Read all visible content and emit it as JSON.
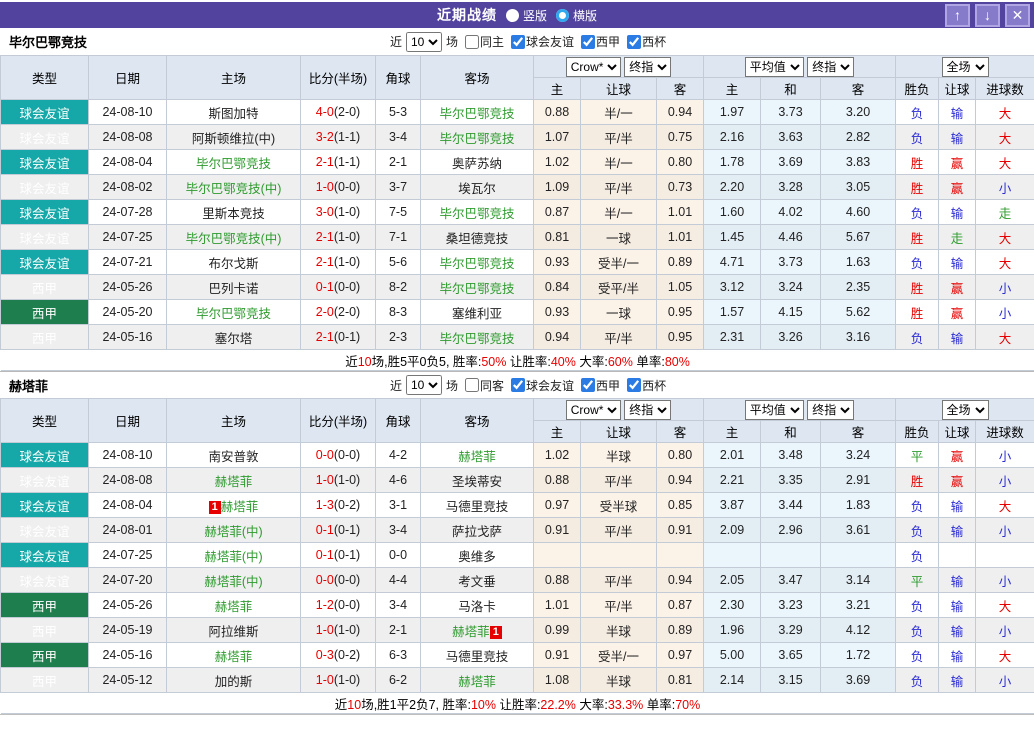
{
  "titlebar": {
    "title": "近期战绩",
    "vertical_label": "竖版",
    "horizontal_label": "横版",
    "up_icon": "↑",
    "down_icon": "↓",
    "close_icon": "✕"
  },
  "colors": {
    "titlebar_purple": "#52439E",
    "button_purple": "#867BCB",
    "friendly_teal": "#16A8A8",
    "laliga_green": "#1E7E4D",
    "header_blue": "#DDE6F1",
    "focus_team_green": "#2E9B2E",
    "win_red": "#E60000",
    "lose_blue": "#2B2BD5",
    "draw_green": "#2E9B2E"
  },
  "filter": {
    "near": "近",
    "count": "10",
    "games": "场"
  },
  "columns": {
    "type": "类型",
    "date": "日期",
    "home": "主场",
    "score": "比分(半场)",
    "corner": "角球",
    "away": "客场",
    "crow_select": "Crow*",
    "final_select": "终指",
    "avg_select": "平均值",
    "full_select": "全场",
    "sub": [
      "主",
      "让球",
      "客",
      "主",
      "和",
      "客",
      "胜负",
      "让球",
      "进球数"
    ]
  },
  "sections": [
    {
      "team": "毕尔巴鄂竞技",
      "same_label": "同主",
      "same_checked": false,
      "leagues": [
        "球会友谊",
        "西甲",
        "西杯"
      ],
      "rows": [
        {
          "tp": "球会友谊",
          "lg": "f",
          "dt": "24-08-10",
          "hm": "斯图加特",
          "hg": 0,
          "hb": "",
          "sc": "4-0",
          "hf": "(2-0)",
          "cn": "5-3",
          "aw": "毕尔巴鄂竞技",
          "ag": 1,
          "ab": "",
          "od": [
            "0.88",
            "半/一",
            "0.94"
          ],
          "av": [
            "1.97",
            "3.73",
            "3.20"
          ],
          "rs": [
            [
              "负",
              "b"
            ],
            [
              "输",
              "b"
            ],
            [
              "大",
              "r"
            ]
          ]
        },
        {
          "tp": "球会友谊",
          "lg": "f",
          "dt": "24-08-08",
          "hm": "阿斯顿维拉(中)",
          "hg": 0,
          "hb": "",
          "sc": "3-2",
          "hf": "(1-1)",
          "cn": "3-4",
          "aw": "毕尔巴鄂竞技",
          "ag": 1,
          "ab": "",
          "od": [
            "1.07",
            "平/半",
            "0.75"
          ],
          "av": [
            "2.16",
            "3.63",
            "2.82"
          ],
          "rs": [
            [
              "负",
              "b"
            ],
            [
              "输",
              "b"
            ],
            [
              "大",
              "r"
            ]
          ]
        },
        {
          "tp": "球会友谊",
          "lg": "f",
          "dt": "24-08-04",
          "hm": "毕尔巴鄂竞技",
          "hg": 1,
          "hb": "",
          "sc": "2-1",
          "hf": "(1-1)",
          "cn": "2-1",
          "aw": "奥萨苏纳",
          "ag": 0,
          "ab": "",
          "od": [
            "1.02",
            "半/一",
            "0.80"
          ],
          "av": [
            "1.78",
            "3.69",
            "3.83"
          ],
          "rs": [
            [
              "胜",
              "r"
            ],
            [
              "赢",
              "r"
            ],
            [
              "大",
              "r"
            ]
          ]
        },
        {
          "tp": "球会友谊",
          "lg": "f",
          "dt": "24-08-02",
          "hm": "毕尔巴鄂竞技(中)",
          "hg": 1,
          "hb": "",
          "sc": "1-0",
          "hf": "(0-0)",
          "cn": "3-7",
          "aw": "埃瓦尔",
          "ag": 0,
          "ab": "",
          "od": [
            "1.09",
            "平/半",
            "0.73"
          ],
          "av": [
            "2.20",
            "3.28",
            "3.05"
          ],
          "rs": [
            [
              "胜",
              "r"
            ],
            [
              "赢",
              "r"
            ],
            [
              "小",
              "b"
            ]
          ]
        },
        {
          "tp": "球会友谊",
          "lg": "f",
          "dt": "24-07-28",
          "hm": "里斯本竞技",
          "hg": 0,
          "hb": "",
          "sc": "3-0",
          "hf": "(1-0)",
          "cn": "7-5",
          "aw": "毕尔巴鄂竞技",
          "ag": 1,
          "ab": "",
          "od": [
            "0.87",
            "半/一",
            "1.01"
          ],
          "av": [
            "1.60",
            "4.02",
            "4.60"
          ],
          "rs": [
            [
              "负",
              "b"
            ],
            [
              "输",
              "b"
            ],
            [
              "走",
              "g"
            ]
          ]
        },
        {
          "tp": "球会友谊",
          "lg": "f",
          "dt": "24-07-25",
          "hm": "毕尔巴鄂竞技(中)",
          "hg": 1,
          "hb": "",
          "sc": "2-1",
          "hf": "(1-0)",
          "cn": "7-1",
          "aw": "桑坦德竞技",
          "ag": 0,
          "ab": "",
          "od": [
            "0.81",
            "一球",
            "1.01"
          ],
          "av": [
            "1.45",
            "4.46",
            "5.67"
          ],
          "rs": [
            [
              "胜",
              "r"
            ],
            [
              "走",
              "g"
            ],
            [
              "大",
              "r"
            ]
          ]
        },
        {
          "tp": "球会友谊",
          "lg": "f",
          "dt": "24-07-21",
          "hm": "布尔戈斯",
          "hg": 0,
          "hb": "",
          "sc": "2-1",
          "hf": "(1-0)",
          "cn": "5-6",
          "aw": "毕尔巴鄂竞技",
          "ag": 1,
          "ab": "",
          "od": [
            "0.93",
            "受半/一",
            "0.89"
          ],
          "av": [
            "4.71",
            "3.73",
            "1.63"
          ],
          "rs": [
            [
              "负",
              "b"
            ],
            [
              "输",
              "b"
            ],
            [
              "大",
              "r"
            ]
          ]
        },
        {
          "tp": "西甲",
          "lg": "l",
          "dt": "24-05-26",
          "hm": "巴列卡诺",
          "hg": 0,
          "hb": "",
          "sc": "0-1",
          "hf": "(0-0)",
          "cn": "8-2",
          "aw": "毕尔巴鄂竞技",
          "ag": 1,
          "ab": "",
          "od": [
            "0.84",
            "受平/半",
            "1.05"
          ],
          "av": [
            "3.12",
            "3.24",
            "2.35"
          ],
          "rs": [
            [
              "胜",
              "r"
            ],
            [
              "赢",
              "r"
            ],
            [
              "小",
              "b"
            ]
          ]
        },
        {
          "tp": "西甲",
          "lg": "l",
          "dt": "24-05-20",
          "hm": "毕尔巴鄂竞技",
          "hg": 1,
          "hb": "",
          "sc": "2-0",
          "hf": "(2-0)",
          "cn": "8-3",
          "aw": "塞维利亚",
          "ag": 0,
          "ab": "",
          "od": [
            "0.93",
            "一球",
            "0.95"
          ],
          "av": [
            "1.57",
            "4.15",
            "5.62"
          ],
          "rs": [
            [
              "胜",
              "r"
            ],
            [
              "赢",
              "r"
            ],
            [
              "小",
              "b"
            ]
          ]
        },
        {
          "tp": "西甲",
          "lg": "l",
          "dt": "24-05-16",
          "hm": "塞尔塔",
          "hg": 0,
          "hb": "",
          "sc": "2-1",
          "hf": "(0-1)",
          "cn": "2-3",
          "aw": "毕尔巴鄂竞技",
          "ag": 1,
          "ab": "",
          "od": [
            "0.94",
            "平/半",
            "0.95"
          ],
          "av": [
            "2.31",
            "3.26",
            "3.16"
          ],
          "rs": [
            [
              "负",
              "b"
            ],
            [
              "输",
              "b"
            ],
            [
              "大",
              "r"
            ]
          ]
        }
      ],
      "summary_parts": [
        [
          "近",
          "k"
        ],
        [
          "10",
          "r"
        ],
        [
          "场,胜5平0负5, 胜率:",
          "k"
        ],
        [
          "50%",
          "r"
        ],
        [
          " 让胜率:",
          "k"
        ],
        [
          "40%",
          "r"
        ],
        [
          " 大率:",
          "k"
        ],
        [
          "60%",
          "r"
        ],
        [
          " 单率:",
          "k"
        ],
        [
          "80%",
          "r"
        ]
      ]
    },
    {
      "team": "赫塔菲",
      "same_label": "同客",
      "same_checked": false,
      "leagues": [
        "球会友谊",
        "西甲",
        "西杯"
      ],
      "rows": [
        {
          "tp": "球会友谊",
          "lg": "f",
          "dt": "24-08-10",
          "hm": "南安普敦",
          "hg": 0,
          "hb": "",
          "sc": "0-0",
          "hf": "(0-0)",
          "cn": "4-2",
          "aw": "赫塔菲",
          "ag": 1,
          "ab": "",
          "od": [
            "1.02",
            "半球",
            "0.80"
          ],
          "av": [
            "2.01",
            "3.48",
            "3.24"
          ],
          "rs": [
            [
              "平",
              "g"
            ],
            [
              "赢",
              "r"
            ],
            [
              "小",
              "b"
            ]
          ]
        },
        {
          "tp": "球会友谊",
          "lg": "f",
          "dt": "24-08-08",
          "hm": "赫塔菲",
          "hg": 1,
          "hb": "",
          "sc": "1-0",
          "hf": "(1-0)",
          "cn": "4-6",
          "aw": "圣埃蒂安",
          "ag": 0,
          "ab": "",
          "od": [
            "0.88",
            "平/半",
            "0.94"
          ],
          "av": [
            "2.21",
            "3.35",
            "2.91"
          ],
          "rs": [
            [
              "胜",
              "r"
            ],
            [
              "赢",
              "r"
            ],
            [
              "小",
              "b"
            ]
          ]
        },
        {
          "tp": "球会友谊",
          "lg": "f",
          "dt": "24-08-04",
          "hm": "赫塔菲",
          "hg": 1,
          "hb": "1",
          "sc": "1-3",
          "hf": "(0-2)",
          "cn": "3-1",
          "aw": "马德里竞技",
          "ag": 0,
          "ab": "",
          "od": [
            "0.97",
            "受半球",
            "0.85"
          ],
          "av": [
            "3.87",
            "3.44",
            "1.83"
          ],
          "rs": [
            [
              "负",
              "b"
            ],
            [
              "输",
              "b"
            ],
            [
              "大",
              "r"
            ]
          ]
        },
        {
          "tp": "球会友谊",
          "lg": "f",
          "dt": "24-08-01",
          "hm": "赫塔菲(中)",
          "hg": 1,
          "hb": "",
          "sc": "0-1",
          "hf": "(0-1)",
          "cn": "3-4",
          "aw": "萨拉戈萨",
          "ag": 0,
          "ab": "",
          "od": [
            "0.91",
            "平/半",
            "0.91"
          ],
          "av": [
            "2.09",
            "2.96",
            "3.61"
          ],
          "rs": [
            [
              "负",
              "b"
            ],
            [
              "输",
              "b"
            ],
            [
              "小",
              "b"
            ]
          ]
        },
        {
          "tp": "球会友谊",
          "lg": "f",
          "dt": "24-07-25",
          "hm": "赫塔菲(中)",
          "hg": 1,
          "hb": "",
          "sc": "0-1",
          "hf": "(0-1)",
          "cn": "0-0",
          "aw": "奥维多",
          "ag": 0,
          "ab": "",
          "od": [
            "",
            "",
            ""
          ],
          "av": [
            "",
            "",
            ""
          ],
          "rs": [
            [
              "负",
              "b"
            ],
            [
              "",
              ""
            ],
            [
              "",
              ""
            ]
          ]
        },
        {
          "tp": "球会友谊",
          "lg": "f",
          "dt": "24-07-20",
          "hm": "赫塔菲(中)",
          "hg": 1,
          "hb": "",
          "sc": "0-0",
          "hf": "(0-0)",
          "cn": "4-4",
          "aw": "考文垂",
          "ag": 0,
          "ab": "",
          "od": [
            "0.88",
            "平/半",
            "0.94"
          ],
          "av": [
            "2.05",
            "3.47",
            "3.14"
          ],
          "rs": [
            [
              "平",
              "g"
            ],
            [
              "输",
              "b"
            ],
            [
              "小",
              "b"
            ]
          ]
        },
        {
          "tp": "西甲",
          "lg": "l",
          "dt": "24-05-26",
          "hm": "赫塔菲",
          "hg": 1,
          "hb": "",
          "sc": "1-2",
          "hf": "(0-0)",
          "cn": "3-4",
          "aw": "马洛卡",
          "ag": 0,
          "ab": "",
          "od": [
            "1.01",
            "平/半",
            "0.87"
          ],
          "av": [
            "2.30",
            "3.23",
            "3.21"
          ],
          "rs": [
            [
              "负",
              "b"
            ],
            [
              "输",
              "b"
            ],
            [
              "大",
              "r"
            ]
          ]
        },
        {
          "tp": "西甲",
          "lg": "l",
          "dt": "24-05-19",
          "hm": "阿拉维斯",
          "hg": 0,
          "hb": "",
          "sc": "1-0",
          "hf": "(1-0)",
          "cn": "2-1",
          "aw": "赫塔菲",
          "ag": 1,
          "ab": "1",
          "od": [
            "0.99",
            "半球",
            "0.89"
          ],
          "av": [
            "1.96",
            "3.29",
            "4.12"
          ],
          "rs": [
            [
              "负",
              "b"
            ],
            [
              "输",
              "b"
            ],
            [
              "小",
              "b"
            ]
          ]
        },
        {
          "tp": "西甲",
          "lg": "l",
          "dt": "24-05-16",
          "hm": "赫塔菲",
          "hg": 1,
          "hb": "",
          "sc": "0-3",
          "hf": "(0-2)",
          "cn": "6-3",
          "aw": "马德里竞技",
          "ag": 0,
          "ab": "",
          "od": [
            "0.91",
            "受半/一",
            "0.97"
          ],
          "av": [
            "5.00",
            "3.65",
            "1.72"
          ],
          "rs": [
            [
              "负",
              "b"
            ],
            [
              "输",
              "b"
            ],
            [
              "大",
              "r"
            ]
          ]
        },
        {
          "tp": "西甲",
          "lg": "l",
          "dt": "24-05-12",
          "hm": "加的斯",
          "hg": 0,
          "hb": "",
          "sc": "1-0",
          "hf": "(1-0)",
          "cn": "6-2",
          "aw": "赫塔菲",
          "ag": 1,
          "ab": "",
          "od": [
            "1.08",
            "半球",
            "0.81"
          ],
          "av": [
            "2.14",
            "3.15",
            "3.69"
          ],
          "rs": [
            [
              "负",
              "b"
            ],
            [
              "输",
              "b"
            ],
            [
              "小",
              "b"
            ]
          ]
        }
      ],
      "summary_parts": [
        [
          "近",
          "k"
        ],
        [
          "10",
          "r"
        ],
        [
          "场,胜1平2负7, 胜率:",
          "k"
        ],
        [
          "10%",
          "r"
        ],
        [
          " 让胜率:",
          "k"
        ],
        [
          "22.2%",
          "r"
        ],
        [
          " 大率:",
          "k"
        ],
        [
          "33.3%",
          "r"
        ],
        [
          " 单率:",
          "k"
        ],
        [
          "70%",
          "r"
        ]
      ]
    }
  ]
}
